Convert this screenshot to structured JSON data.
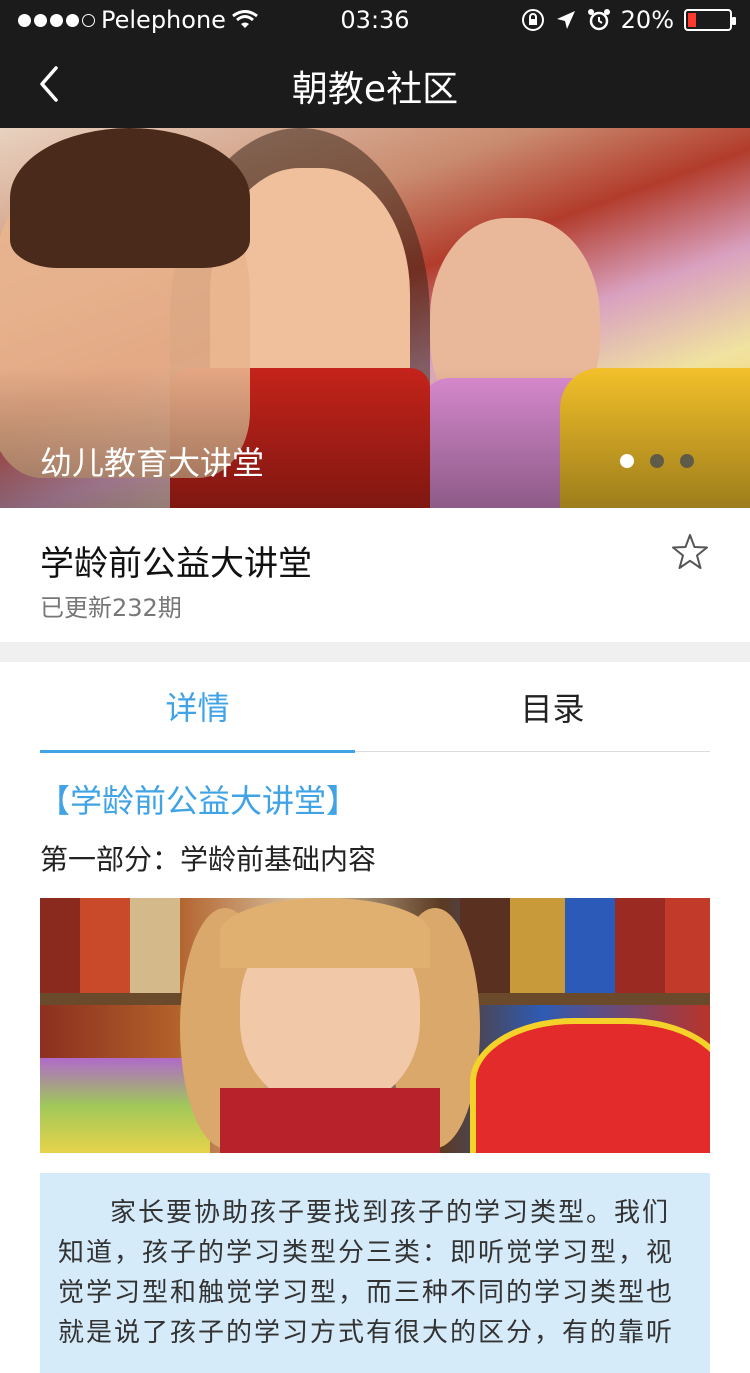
{
  "status_bar": {
    "carrier": "Pelephone",
    "time": "03:36",
    "battery": "20%",
    "battery_level": 0.2
  },
  "nav": {
    "title": "朝教e社区"
  },
  "banner": {
    "caption": "幼儿教育大讲堂",
    "page_count": 3,
    "active_page": 1
  },
  "course": {
    "name": "学龄前公益大讲堂",
    "updated": "已更新232期"
  },
  "tabs": [
    {
      "label": "详情",
      "active": true
    },
    {
      "label": "目录",
      "active": false
    }
  ],
  "detail": {
    "section_title": "【学龄前公益大讲堂】",
    "section_subtitle": "第一部分：学龄前基础内容",
    "paragraph": "家长要协助孩子要找到孩子的学习类型。我们知道，孩子的学习类型分三类：即听觉学习型，视觉学习型和触觉学习型，而三种不同的学习类型也就是说了孩子的学习方式有很大的区分，有的靠听"
  },
  "colors": {
    "accent": "#3fa3e6",
    "bar": "#1b1b1b",
    "paragraph_bg": "#d6ebfa"
  },
  "icons": {
    "back": "back-chevron-icon",
    "favorite": "star-outline-icon",
    "wifi": "wifi-icon",
    "lock_rotation": "rotation-lock-icon",
    "location": "location-arrow-icon",
    "alarm": "alarm-clock-icon"
  }
}
